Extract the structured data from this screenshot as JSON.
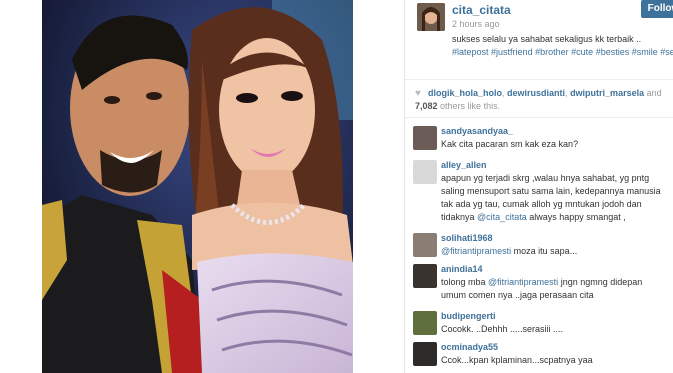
{
  "post": {
    "owner": "cita_citata",
    "follow_label": "Follow",
    "time": "2 hours ago",
    "caption_text": "sukses selalu ya sahabat sekaligus kk terbaik ..",
    "hashtags": [
      "#latepost",
      "#justfriend",
      "#brother",
      "#cute",
      "#besties",
      "#smile",
      "#selfi"
    ]
  },
  "likes": {
    "users": [
      "dlogik_hola_holo",
      "dewirusdianti",
      "dwiputri_marsela"
    ],
    "and": "and",
    "count": "7,082",
    "suffix": "others like this."
  },
  "comments": [
    {
      "user": "sandyasandyaa_",
      "text": "Kak cita pacaran sm kak eza kan?"
    },
    {
      "user": "alley_allen",
      "text": "apapun yg terjadi skrg ,walau hnya sahabat, yg pntg saling mensuport satu sama lain, kedepannya manusia tak ada yg tau, cumak alloh yg mntukan jodoh dan tidaknya",
      "mention": "@cita_citata",
      "after": " always happy smangat ,"
    },
    {
      "user": "solihati1968",
      "mention": "@fitriantipramesti",
      "text": " moza itu sapa..."
    },
    {
      "user": "anindia14",
      "text": "tolong mba ",
      "mention": "@fitriantipramesti",
      "after": " jngn ngmng didepan umum comen nya ..jaga perasaan cita"
    },
    {
      "user": "budipengerti",
      "text": "Cocokk. ..Dehhh .....serasiii ...."
    },
    {
      "user": "ocminadya55",
      "text": "Ccok...kpan kplaminan...scpatnya yaa"
    }
  ],
  "colors": {
    "link": "#3f729b",
    "follow_bg": "#3f729b",
    "muted": "#999999"
  }
}
